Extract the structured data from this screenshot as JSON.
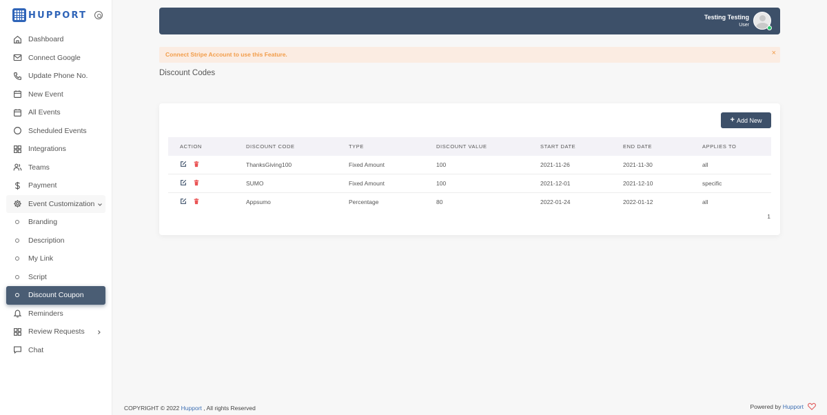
{
  "brand": {
    "name": "HUPPORT"
  },
  "sidebar": {
    "items": [
      {
        "label": "Dashboard",
        "icon": "home-icon"
      },
      {
        "label": "Connect Google",
        "icon": "mail-icon"
      },
      {
        "label": "Update Phone No.",
        "icon": "phone-icon"
      },
      {
        "label": "New Event",
        "icon": "calendar-icon"
      },
      {
        "label": "All Events",
        "icon": "calendar-icon"
      },
      {
        "label": "Scheduled Events",
        "icon": "circle-icon"
      },
      {
        "label": "Integrations",
        "icon": "grid-icon"
      },
      {
        "label": "Teams",
        "icon": "users-icon"
      },
      {
        "label": "Payment",
        "icon": "dollar-icon"
      },
      {
        "label": "Event Customization",
        "icon": "gear-icon"
      }
    ],
    "sub_items": [
      {
        "label": "Branding"
      },
      {
        "label": "Description"
      },
      {
        "label": "My Link"
      },
      {
        "label": "Script"
      },
      {
        "label": "Discount Coupon",
        "active": true
      }
    ],
    "bottom_items": [
      {
        "label": "Reminders",
        "icon": "bell-icon"
      },
      {
        "label": "Review Requests",
        "icon": "grid-icon"
      },
      {
        "label": "Chat",
        "icon": "message-icon"
      }
    ]
  },
  "header": {
    "user_name": "Testing Testing",
    "user_role": "User"
  },
  "alert": {
    "text": "Connect Stripe Account to use this Feature.",
    "close": "×"
  },
  "page": {
    "title": "Discount Codes"
  },
  "card": {
    "add_button": "Add New",
    "add_icon": "+"
  },
  "table": {
    "columns": [
      "Action",
      "Discount Code",
      "Type",
      "Discount Value",
      "Start Date",
      "End Date",
      "Applies To"
    ],
    "rows": [
      {
        "code": "ThanksGiving100",
        "type": "Fixed Amount",
        "value": "100",
        "start": "2021-11-26",
        "end": "2021-11-30",
        "applies": "all"
      },
      {
        "code": "SUMO",
        "type": "Fixed Amount",
        "value": "100",
        "start": "2021-12-01",
        "end": "2021-12-10",
        "applies": "specific"
      },
      {
        "code": "Appsumo",
        "type": "Percentage",
        "value": "80",
        "start": "2022-01-24",
        "end": "2022-01-12",
        "applies": "all"
      }
    ]
  },
  "pagination": {
    "page": "1"
  },
  "footer": {
    "copyright": "COPYRIGHT © 2022",
    "company": "Hupport",
    "rights": ", All rights Reserved",
    "powered": "Powered by",
    "powered_link": "Hupport"
  },
  "colors": {
    "primary": "#3d5069",
    "alert_text": "#f29d4a",
    "alert_bg": "#fbece2",
    "delete": "#ea5455",
    "edit": "#3d5069"
  }
}
